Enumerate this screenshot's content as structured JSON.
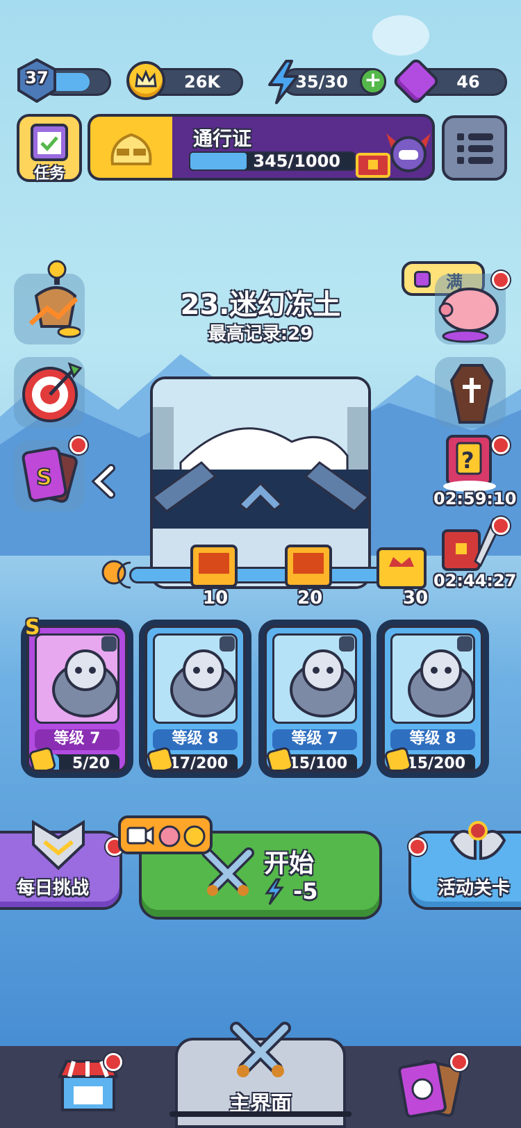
{
  "top_bar": {
    "level": "37",
    "coins": "26K",
    "energy": "35/30",
    "gems": "46"
  },
  "tasks": {
    "label": "任务"
  },
  "pass": {
    "title": "通行证",
    "progress_text": "345/1000",
    "progress": 0.345
  },
  "piggy": {
    "label": "满"
  },
  "stage": {
    "title": "23.迷幻冻土",
    "best_record": "最高记录:29"
  },
  "timers": {
    "mystery_card": "02:59:10",
    "chest_sword": "02:44:27"
  },
  "milestones": [
    {
      "label": "10"
    },
    {
      "label": "20"
    },
    {
      "label": "30"
    }
  ],
  "heroes": [
    {
      "rank": "S",
      "level": "等级 7",
      "progress": "5/20",
      "fill": 0.25,
      "theme": "purple",
      "badge": "bat-icon"
    },
    {
      "level": "等级 8",
      "progress": "17/200",
      "fill": 0.085,
      "theme": "blue",
      "badge": "sword-icon"
    },
    {
      "level": "等级 7",
      "progress": "15/100",
      "fill": 0.15,
      "theme": "blue",
      "badge": "fire-icon"
    },
    {
      "level": "等级 8",
      "progress": "15/200",
      "fill": 0.075,
      "theme": "blue",
      "badge": "potion-icon"
    }
  ],
  "buttons": {
    "daily": "每日挑战",
    "start": "开始",
    "start_cost": "-5",
    "event": "活动关卡"
  },
  "nav": {
    "home": "主界面"
  },
  "colors": {
    "accent_green": "#55b84a",
    "accent_purple": "#b24be0",
    "gold": "#ffc82d"
  }
}
